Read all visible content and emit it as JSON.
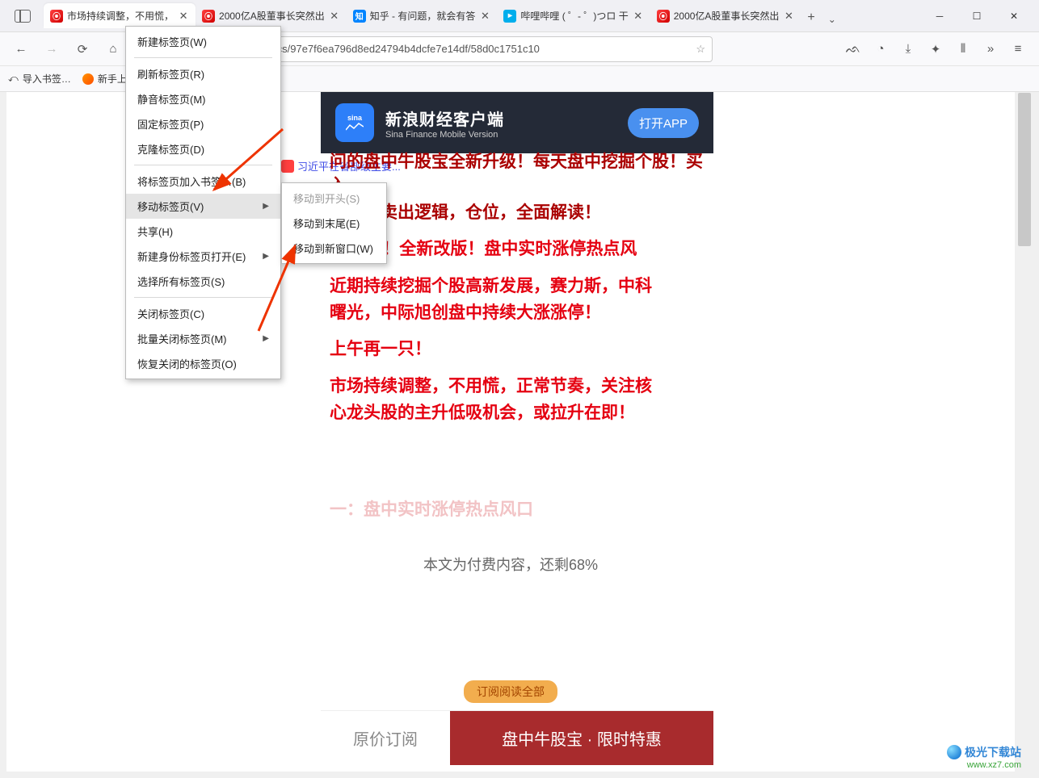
{
  "tabs": [
    {
      "title": "市场持续调整，不用慌，",
      "favicon": "sina"
    },
    {
      "title": "2000亿A股董事长突然出",
      "favicon": "sina"
    },
    {
      "title": "知乎 - 有问题，就会有答",
      "favicon": "zhihu"
    },
    {
      "title": "哔哩哔哩 (  ゜- ゜)つロ 干",
      "favicon": "bili"
    },
    {
      "title": "2000亿A股董事长突然出",
      "favicon": "sina"
    }
  ],
  "url": "axue.sina.cn/detail/graphics/97e7f6ea796d8ed24794b4dcfe7e14df/58d0c1751c10",
  "bookmarks": {
    "import": "导入书签…",
    "getting_started": "新手上"
  },
  "topbar_link": "习近平在省部级主要...",
  "banner": {
    "title_cn": "新浪财经客户端",
    "title_en": "Sina Finance Mobile Version",
    "button": "打开APP",
    "logo_text": "sina"
  },
  "article": {
    "line0a": "问的盘中牛股宝全新升级！每天盘中挖掘个股！买入",
    "line0b": "逻辑，卖出逻辑，仓位，全面解读！",
    "line1": "月15日！全新改版！盘中实时涨停热点风",
    "line2a": "近期持续挖掘个股高新发展，赛力斯，中科",
    "line2b": "曙光，中际旭创盘中持续大涨涨停！",
    "line3": "上午再一只！",
    "line4a": "市场持续调整，不用慌，正常节奏，关注核",
    "line4b": "心龙头股的主升低吸机会，或拉升在即！",
    "faint": "一：盘中实时涨停热点风口"
  },
  "paywall": "本文为付费内容，还剩68%",
  "subscribe_pill": "订阅阅读全部",
  "subscribe_bar": {
    "left": "原价订阅",
    "right": "盘中牛股宝 · 限时特惠"
  },
  "context_menu": {
    "new_tab": "新建标签页(W)",
    "reload": "刷新标签页(R)",
    "mute": "静音标签页(M)",
    "pin": "固定标签页(P)",
    "clone": "克隆标签页(D)",
    "bookmark": "将标签页加入书签…(B)",
    "move": "移动标签页(V)",
    "share": "共享(H)",
    "new_container": "新建身份标签页打开(E)",
    "select_all": "选择所有标签页(S)",
    "close": "关闭标签页(C)",
    "close_multi": "批量关闭标签页(M)",
    "reopen": "恢复关闭的标签页(O)"
  },
  "submenu": {
    "to_start": "移动到开头(S)",
    "to_end": "移动到末尾(E)",
    "to_new_window": "移动到新窗口(W)"
  },
  "watermark": {
    "name": "极光下载站",
    "url": "www.xz7.com"
  }
}
